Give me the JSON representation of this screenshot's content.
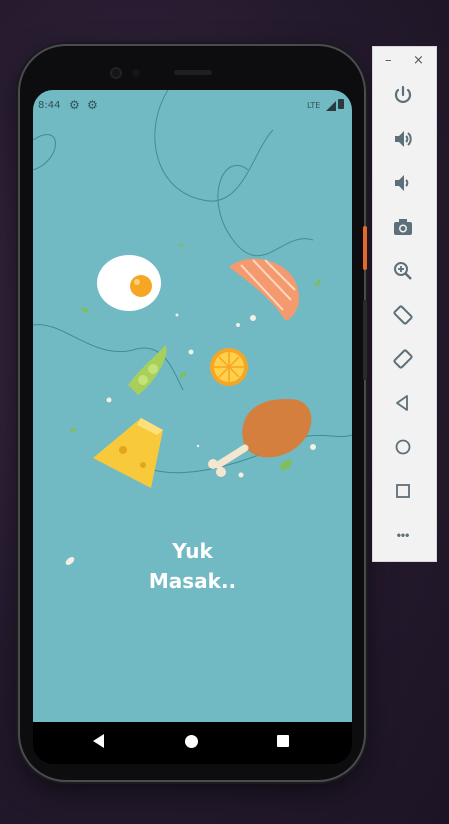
{
  "status_bar": {
    "time": "8:44",
    "network": "LTE"
  },
  "splash": {
    "title_line1": "Yuk",
    "title_line2": "Masak.."
  },
  "emulator_toolbar": {
    "minimize": "–",
    "close": "×",
    "tools": [
      "power-icon",
      "volume-up-icon",
      "volume-down-icon",
      "camera-icon",
      "zoom-icon",
      "rotate-left-icon",
      "rotate-right-icon",
      "back-icon",
      "home-icon",
      "overview-icon",
      "more-icon"
    ],
    "more": "•••"
  },
  "colors": {
    "screen_bg": "#72bac3",
    "accent": "#e3672f",
    "toolbar_icon": "#5d6f78"
  }
}
